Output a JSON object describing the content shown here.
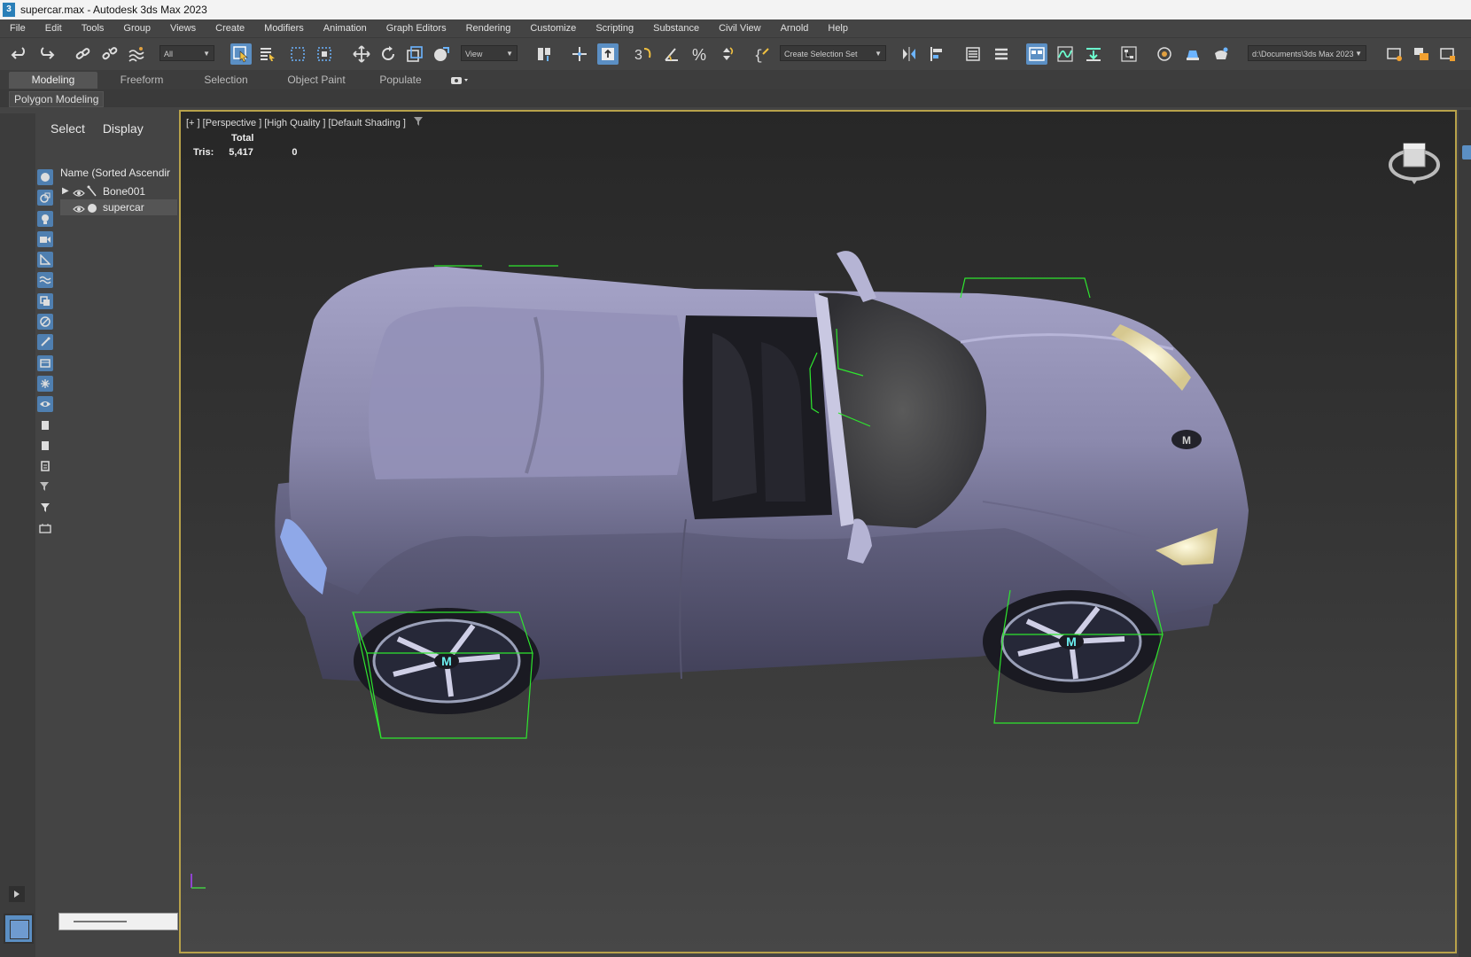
{
  "window": {
    "title": "supercar.max - Autodesk 3ds Max 2023",
    "app_icon_glyph": "3"
  },
  "menu": [
    "File",
    "Edit",
    "Tools",
    "Group",
    "Views",
    "Create",
    "Modifiers",
    "Animation",
    "Graph Editors",
    "Rendering",
    "Customize",
    "Scripting",
    "Substance",
    "Civil View",
    "Arnold",
    "Help"
  ],
  "toolbar": {
    "filter_value": "All",
    "view_value": "View",
    "selection_set_placeholder": "Create Selection Set",
    "project_path": "d:\\Documents\\3ds Max 2023",
    "icons": [
      "undo-icon",
      "redo-icon",
      "link-icon",
      "unlink-icon",
      "bind-space-warp-icon",
      "select-object-icon",
      "select-by-name-icon",
      "rect-selection-icon",
      "window-crossing-icon",
      "move-icon",
      "rotate-icon",
      "scale-icon",
      "place-icon",
      "select-manipulate-icon",
      "snap-3d-icon",
      "angle-snap-icon",
      "percent-snap-icon",
      "spinner-snap-icon",
      "named-selection-icon",
      "mirror-icon",
      "align-icon",
      "layer-explorer-icon",
      "toggle-ribbon-icon",
      "scene-explorer-icon",
      "curve-editor-icon",
      "schematic-view-icon",
      "material-editor-icon",
      "render-setup-icon",
      "rendered-frame-icon",
      "render-icon",
      "project-folder-icon"
    ]
  },
  "ribbon": {
    "tabs": [
      "Modeling",
      "Freeform",
      "Selection",
      "Object Paint",
      "Populate"
    ],
    "active_tab": "Modeling",
    "sub_label": "Polygon Modeling"
  },
  "scene_explorer": {
    "tabs": [
      "Select",
      "Display"
    ],
    "column_header": "Name (Sorted Ascendir",
    "items": [
      {
        "name": "Bone001",
        "type": "bone"
      },
      {
        "name": "supercar",
        "type": "geometry"
      }
    ]
  },
  "viewport": {
    "label": "[+ ] [Perspective ] [High Quality ] [Default Shading ]",
    "stats_header": "Total",
    "stats_label": "Tris:",
    "stats_total": "5,417",
    "stats_selected": "0",
    "badge_letter": "M"
  },
  "colors": {
    "accent": "#5b8fc4",
    "viewport_border": "#b8a24a",
    "bone_wire": "#2ee62e",
    "car_body": "#8c8aac"
  }
}
